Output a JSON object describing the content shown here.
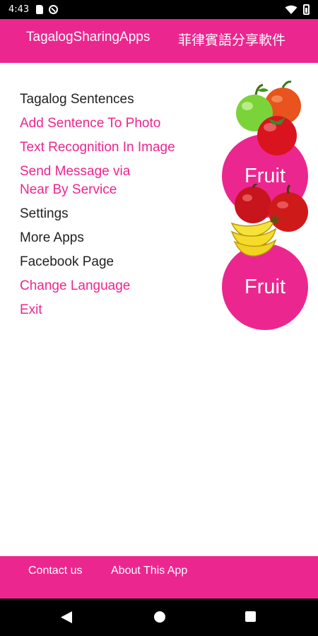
{
  "status_bar": {
    "time": "4:43",
    "icons": [
      "sd-card-icon",
      "do-not-disturb-icon",
      "wifi-icon",
      "battery-icon"
    ]
  },
  "app_bar": {
    "title": "TagalogSharingApps",
    "title_zh": "菲律賓語分享軟件",
    "background": "#ec268f"
  },
  "menu": {
    "items": [
      {
        "label": "Tagalog Sentences",
        "color": "#222222"
      },
      {
        "label": "Add Sentence To Photo",
        "color": "#ec268f"
      },
      {
        "label": "Text Recognition In Image",
        "color": "#ec268f"
      },
      {
        "label_line1": "Send Message via",
        "label_line2": "Near By Service",
        "color": "#ec268f"
      },
      {
        "label": "Settings",
        "color": "#222222"
      },
      {
        "label": "More Apps",
        "color": "#222222"
      },
      {
        "label": "Facebook Page",
        "color": "#222222"
      },
      {
        "label": "Change Language",
        "color": "#ec268f"
      },
      {
        "label": "Exit",
        "color": "#ec268f"
      }
    ]
  },
  "fruit_buttons": [
    {
      "label": "Fruit",
      "image": "apple-tomato-icon"
    },
    {
      "label": "Fruit",
      "image": "apple-banana-icon"
    }
  ],
  "bottom_bar": {
    "contact_label": "Contact us",
    "about_label": "About This App"
  },
  "nav_bar": {
    "icons": [
      "back-icon",
      "home-icon",
      "recents-icon"
    ]
  }
}
